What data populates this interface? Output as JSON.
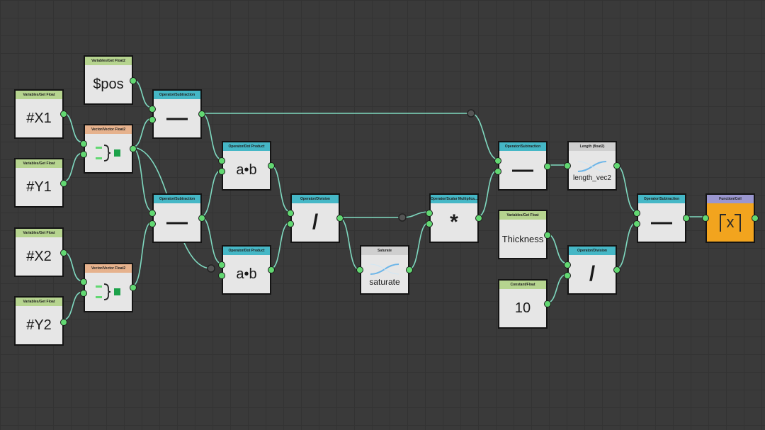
{
  "graph": {
    "nodes": {
      "pos": {
        "header": "Variables/Get Float2",
        "label": "$pos"
      },
      "x1": {
        "header": "Variables/Get Float",
        "label": "#X1"
      },
      "y1": {
        "header": "Variables/Get Float",
        "label": "#Y1"
      },
      "x2": {
        "header": "Variables/Get Float",
        "label": "#X2"
      },
      "y2": {
        "header": "Variables/Get Float",
        "label": "#Y2"
      },
      "vec1": {
        "header": "Vector/Vector Float2"
      },
      "vec2": {
        "header": "Vector/Vector Float2"
      },
      "sub1": {
        "header": "Operator/Subtraction",
        "label": "—"
      },
      "sub2": {
        "header": "Operator/Subtraction",
        "label": "—"
      },
      "dot1": {
        "header": "Operator/Dot Product",
        "label": "a•b"
      },
      "dot2": {
        "header": "Operator/Dot Product",
        "label": "a•b"
      },
      "div1": {
        "header": "Operator/Division",
        "label": "/"
      },
      "saturate": {
        "header": "Saturate",
        "label": "saturate"
      },
      "mul": {
        "header": "Operator/Scalar Multiplica...",
        "label": "*"
      },
      "sub3": {
        "header": "Operator/Subtraction",
        "label": "—"
      },
      "length": {
        "header": "Length (float2)",
        "label": "length_vec2"
      },
      "thickness": {
        "header": "Variables/Get Float",
        "label": "Thickness"
      },
      "const10": {
        "header": "Constant/Float",
        "label": "10"
      },
      "div2": {
        "header": "Operator/Division",
        "label": "/"
      },
      "sub4": {
        "header": "Operator/Subtraction",
        "label": "—"
      },
      "ceil": {
        "header": "Function/Ceil",
        "label": "x"
      }
    }
  },
  "colors": {
    "background": "#3a3a3a",
    "wire": "#7fd9c0",
    "port": "#62d872",
    "variable_header": "#b6d48f",
    "operator_header": "#45b7c6",
    "vector_header": "#e6b28d",
    "function_header": "#9a96cf",
    "function_body": "#f2a41e"
  }
}
